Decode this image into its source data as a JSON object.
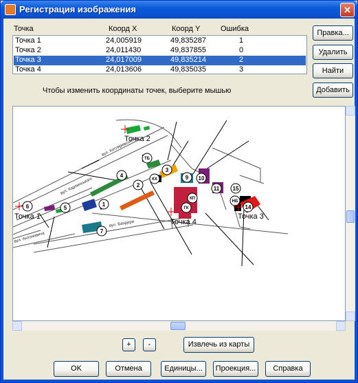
{
  "window": {
    "title": "Регистрация изображения",
    "close_glyph": "✕"
  },
  "table": {
    "headers": {
      "name": "Точка",
      "x": "Коорд X",
      "y": "Коорд Y",
      "error": "Ошибка"
    },
    "rows": [
      {
        "name": "Точка 1",
        "x": "24,005919",
        "y": "49,835287",
        "error": "1"
      },
      {
        "name": "Точка 2",
        "x": "24,011430",
        "y": "49,837855",
        "error": "0"
      },
      {
        "name": "Точка 3",
        "x": "24,017009",
        "y": "49,835214",
        "error": "2",
        "selected": true
      },
      {
        "name": "Точка 4",
        "x": "24,013606",
        "y": "49,835035",
        "error": "3"
      }
    ]
  },
  "side_buttons": {
    "edit": "Правка...",
    "delete": "Удалить",
    "find": "Найти",
    "add": "Добавить"
  },
  "hint": "Чтобы изменить координаты точек, выберите мышью",
  "map": {
    "point_labels": {
      "p1": "Точка 1",
      "p2": "Точка 2",
      "p3": "Точка 3",
      "p4": "Точка 4"
    },
    "building_numbers": [
      "1",
      "2",
      "3",
      "4",
      "5",
      "6",
      "7",
      "9",
      "10",
      "11",
      "14",
      "15"
    ],
    "building_codes": [
      "ТБ",
      "КХ",
      "КП",
      "ГК",
      "НБ"
    ],
    "street_labels": [
      "вул. Бандери",
      "вул. Карпинського",
      "вул. Котляревського",
      "вул. Антоновича"
    ]
  },
  "zoom": {
    "plus": "+",
    "minus": "-"
  },
  "extract_button": "Извлечь из карты",
  "bottom_buttons": {
    "ok": "OK",
    "cancel": "Отмена",
    "units": "Единицы...",
    "projection": "Проекция...",
    "help": "Справка"
  }
}
